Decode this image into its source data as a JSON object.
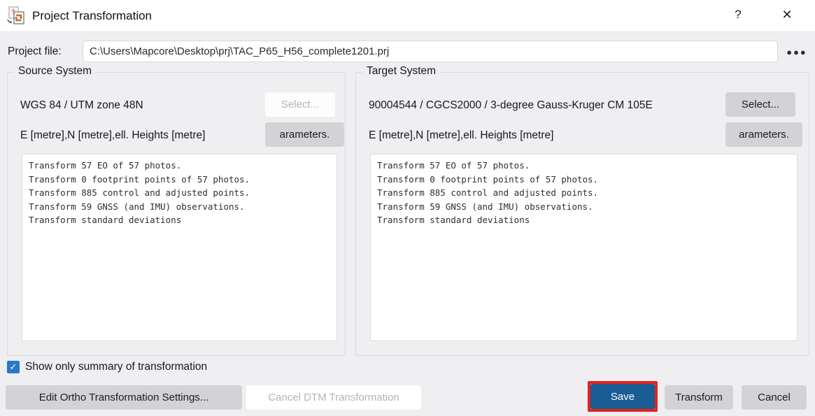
{
  "window": {
    "title": "Project Transformation",
    "help_glyph": "?",
    "close_glyph": "✕"
  },
  "project_file": {
    "label": "Project file:",
    "value": "C:\\Users\\Mapcore\\Desktop\\prj\\TAC_P65_H56_complete1201.prj",
    "browse_glyph": "●●●"
  },
  "source_system": {
    "group_title": "Source System",
    "crs_name": "WGS 84 / UTM zone 48N",
    "select_label": "Select...",
    "units_label": "E [metre],N [metre],ell. Heights [metre]",
    "parameters_label": "arameters.",
    "summary": "Transform 57 EO of 57 photos.\nTransform 0 footprint points of 57 photos.\nTransform 885 control and adjusted points.\nTransform 59 GNSS (and IMU) observations.\nTransform standard deviations"
  },
  "target_system": {
    "group_title": "Target System",
    "crs_name": "90004544 / CGCS2000 / 3-degree Gauss-Kruger CM 105E",
    "select_label": "Select...",
    "units_label": "E [metre],N [metre],ell. Heights [metre]",
    "parameters_label": "arameters.",
    "summary": "Transform 57 EO of 57 photos.\nTransform 0 footprint points of 57 photos.\nTransform 885 control and adjusted points.\nTransform 59 GNSS (and IMU) observations.\nTransform standard deviations"
  },
  "options": {
    "show_summary_label": "Show only summary of transformation",
    "show_summary_checked": true,
    "check_glyph": "✓"
  },
  "footer": {
    "edit_ortho_label": "Edit Ortho Transformation Settings...",
    "cancel_dtm_label": "Cancel DTM Transformation",
    "save_label": "Save",
    "transform_label": "Transform",
    "cancel_label": "Cancel"
  },
  "colors": {
    "save_button_blue": "#1a5c94",
    "checkbox_blue": "#2779c4",
    "highlight_red": "#e3231b",
    "button_gray": "#d3d3d6",
    "body_background": "#efeff1"
  }
}
